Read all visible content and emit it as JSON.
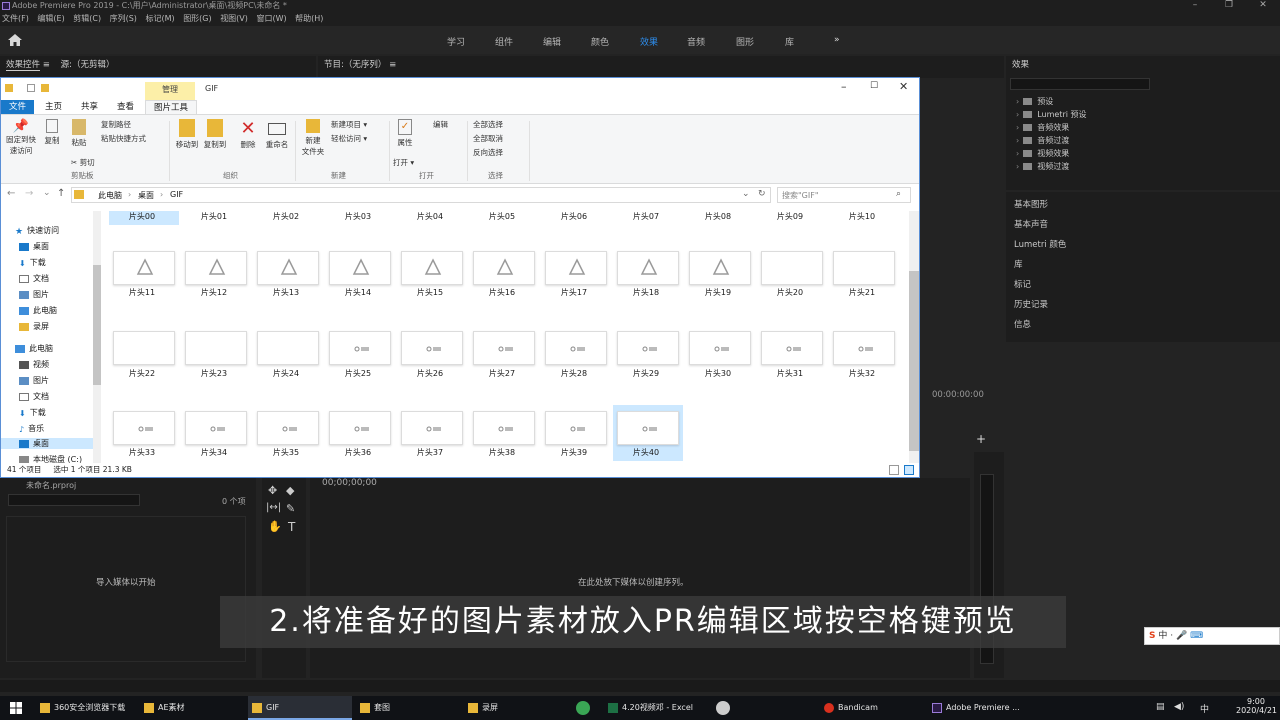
{
  "app": {
    "window_title": "Adobe Premiere Pro 2019 - C:\\用户\\Administrator\\桌面\\视频PC\\未命名 *",
    "menu": [
      "文件(F)",
      "编辑(E)",
      "剪辑(C)",
      "序列(S)",
      "标记(M)",
      "图形(G)",
      "视图(V)",
      "窗口(W)",
      "帮助(H)"
    ],
    "workspaces": [
      "学习",
      "组件",
      "编辑",
      "颜色",
      "效果",
      "音频",
      "图形",
      "库"
    ],
    "active_workspace": "效果",
    "more": "»"
  },
  "panels": {
    "effect_controls_tab": "效果控件",
    "source_tab": "源:（无剪辑）",
    "program_tab": "节目:（无序列）",
    "effects_title": "效果",
    "effects_items": [
      "预设",
      "Lumetri 预设",
      "音频效果",
      "音频过渡",
      "视频效果",
      "视频过渡"
    ],
    "right_list": [
      "基本图形",
      "基本声音",
      "Lumetri 颜色",
      "库",
      "标记",
      "历史记录",
      "信息"
    ],
    "timecode": "00:00:00:00",
    "timeline_timecode": "00;00;00;00",
    "project_name": "未命名.prproj",
    "project_count": "0 个项",
    "import_hint": "导入媒体以开始",
    "drop_hint": "在此处放下媒体以创建序列。"
  },
  "explorer": {
    "title_tab_manage": "管理",
    "title": "GIF",
    "ribbon_tabs": [
      "文件",
      "主页",
      "共享",
      "查看",
      "图片工具"
    ],
    "ribbon": {
      "pin": "固定到快\n速访问",
      "copy": "复制",
      "paste": "粘贴",
      "copy_path": "复制路径",
      "paste_shortcut": "粘贴快捷方式",
      "cut": "剪切",
      "clipboard": "剪贴板",
      "move_to": "移动到",
      "copy_to": "复制到",
      "delete": "删除",
      "rename": "重命名",
      "organize": "组织",
      "new_folder": "新建\n文件夹",
      "new_item": "新建项目 ▾",
      "easy_access": "轻松访问 ▾",
      "new": "新建",
      "properties": "属性",
      "open_btn": "打开 ▾",
      "edit": "编辑",
      "open": "打开",
      "select_all": "全部选择",
      "select_none": "全部取消",
      "invert": "反向选择",
      "select": "选择"
    },
    "breadcrumb": [
      "此电脑",
      "桌面",
      "GIF"
    ],
    "search_placeholder": "搜索\"GIF\"",
    "nav": {
      "quick_access": "快速访问",
      "quick_items": [
        "桌面",
        "下载",
        "文档",
        "图片",
        "此电脑",
        "录屏"
      ],
      "this_pc": "此电脑",
      "pc_items": [
        "视频",
        "图片",
        "文档",
        "下载",
        "音乐",
        "桌面",
        "本地磁盘 (C:)"
      ]
    },
    "files_row0": [
      "片头00",
      "片头01",
      "片头02",
      "片头03",
      "片头04",
      "片头05",
      "片头06",
      "片头07",
      "片头08",
      "片头09",
      "片头10"
    ],
    "files_row1": [
      "片头11",
      "片头12",
      "片头13",
      "片头14",
      "片头15",
      "片头16",
      "片头17",
      "片头18",
      "片头19",
      "片头20",
      "片头21"
    ],
    "files_row2": [
      "片头22",
      "片头23",
      "片头24",
      "片头25",
      "片头26",
      "片头27",
      "片头28",
      "片头29",
      "片头30",
      "片头31",
      "片头32"
    ],
    "files_row3": [
      "片头33",
      "片头34",
      "片头35",
      "片头36",
      "片头37",
      "片头38",
      "片头39",
      "片头40"
    ],
    "status_count": "41 个项目",
    "status_selected": "选中 1 个项目  21.3 KB"
  },
  "subtitle": "2.将准备好的图片素材放入PR编辑区域按空格键预览",
  "ime": "中 ·",
  "taskbar": {
    "items": [
      "360安全浏览器下载",
      "AE素材",
      "GIF",
      "套图",
      "录屏",
      "4.20视频邓 - Excel",
      "Bandicam",
      "Adobe Premiere ..."
    ],
    "time": "9:00",
    "date": "2020/4/21",
    "lang": "中"
  }
}
